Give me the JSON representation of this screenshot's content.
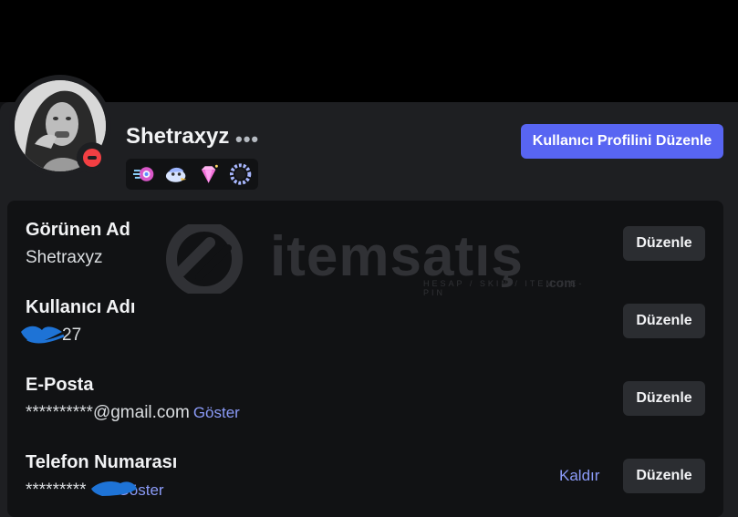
{
  "profile": {
    "username": "Shetraxyz",
    "more_label": "•••",
    "edit_profile_label": "Kullanıcı Profilini Düzenle",
    "badges": [
      "hypesquad-badge",
      "nitro-bird-badge",
      "gem-boost-badge",
      "quest-wreath-badge"
    ],
    "status": "do-not-disturb"
  },
  "fields": {
    "display_name": {
      "label": "Görünen Ad",
      "value": "Shetraxyz",
      "edit": "Düzenle"
    },
    "user_name": {
      "label": "Kullanıcı Adı",
      "value": "27",
      "edit": "Düzenle"
    },
    "email": {
      "label": "E-Posta",
      "value": "**********@gmail.com",
      "reveal": "Göster",
      "edit": "Düzenle"
    },
    "phone": {
      "label": "Telefon Numarası",
      "value": "*********",
      "reveal": "Göster",
      "remove": "Kaldır",
      "edit": "Düzenle"
    }
  },
  "watermark": {
    "brand": "itemsatış",
    "sub": "HESAP / SKIN / ITEM / E-PIN",
    "suffix": ".com"
  },
  "colors": {
    "accent": "#5865f2",
    "link": "#8b9bf8",
    "dnd": "#f23f43",
    "redaction": "#1e73d6"
  }
}
